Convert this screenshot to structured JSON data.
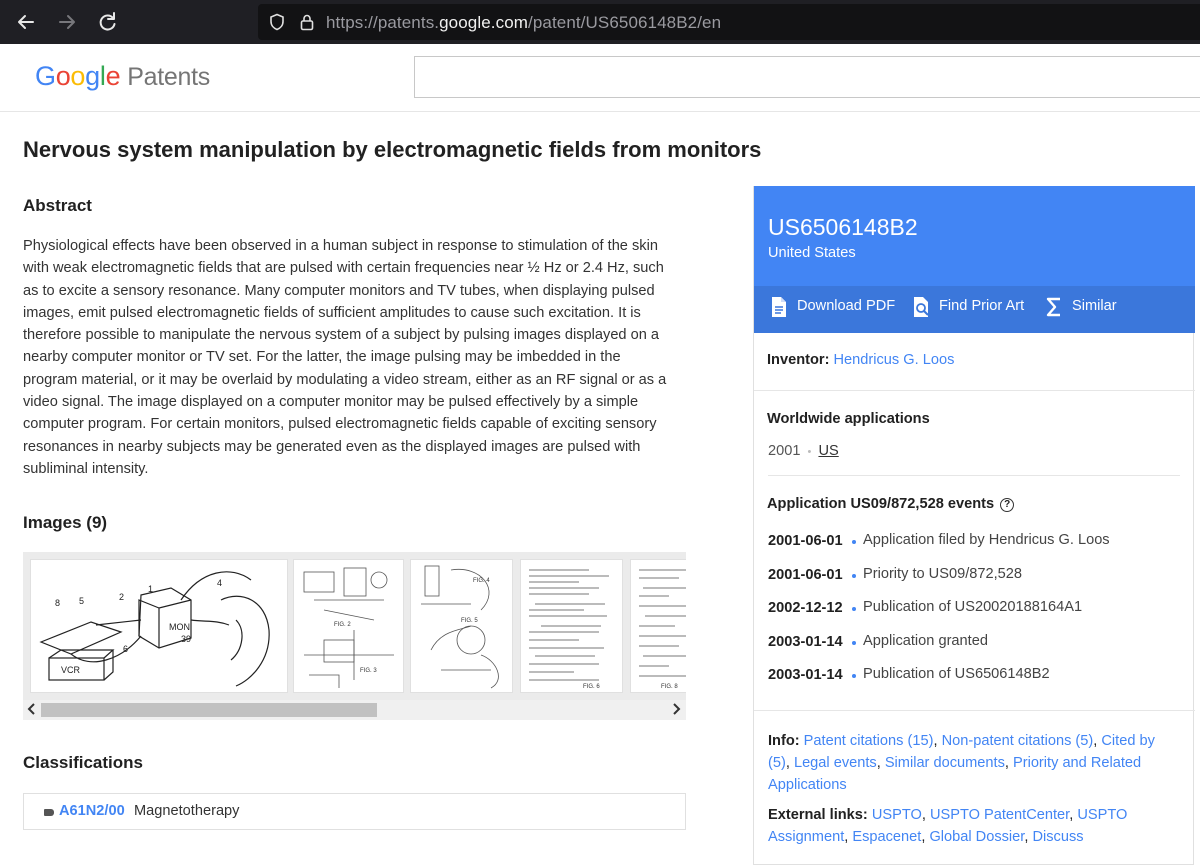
{
  "browser": {
    "url_prefix": "https://patents.",
    "url_host": "google.com",
    "url_path": "/patent/US6506148B2/en"
  },
  "header": {
    "logo_letters": [
      "G",
      "o",
      "o",
      "g",
      "l",
      "e"
    ],
    "logo_product": "Patents"
  },
  "patent": {
    "title": "Nervous system manipulation by electromagnetic fields from monitors",
    "abstract_heading": "Abstract",
    "abstract": "Physiological effects have been observed in a human subject in response to stimulation of the skin with weak electromagnetic fields that are pulsed with certain frequencies near ½ Hz or 2.4 Hz, such as to excite a sensory resonance. Many computer monitors and TV tubes, when displaying pulsed images, emit pulsed electromagnetic fields of sufficient amplitudes to cause such excitation. It is therefore possible to manipulate the nervous system of a subject by pulsing images displayed on a nearby computer monitor or TV set. For the latter, the image pulsing may be imbedded in the program material, or it may be overlaid by modulating a video stream, either as an RF signal or as a video signal. The image displayed on a computer monitor may be pulsed effectively by a simple computer program. For certain monitors, pulsed electromagnetic fields capable of exciting sensory resonances in nearby subjects may be generated even as the displayed images are pulsed with subliminal intensity.",
    "images_heading": "Images (9)",
    "figure_labels": {
      "fig1_labels": [
        "8",
        "5",
        "2",
        "1",
        "4",
        "6",
        "39",
        "VCR",
        "MON"
      ],
      "fig2": "FIG. 2",
      "fig3": "FIG. 3",
      "fig4": "FIG. 4",
      "fig5": "FIG. 5",
      "fig6": "FIG. 6",
      "fig8": "FIG. 8"
    },
    "classifications_heading": "Classifications",
    "classification": {
      "code": "A61N2/00",
      "description": "Magnetotherapy"
    }
  },
  "panel": {
    "publication_number": "US6506148B2",
    "country": "United States",
    "actions": [
      {
        "label": "Download PDF",
        "icon": "document-icon"
      },
      {
        "label": "Find Prior Art",
        "icon": "search-document-icon"
      },
      {
        "label": "Similar",
        "icon": "sigma-icon"
      }
    ],
    "inventor_label": "Inventor:",
    "inventor": "Hendricus G. Loos",
    "worldwide_heading": "Worldwide applications",
    "worldwide_year": "2001",
    "worldwide_country": "US",
    "events_heading": "Application US09/872,528 events",
    "events": [
      {
        "date": "2001-06-01",
        "text": "Application filed by Hendricus G. Loos"
      },
      {
        "date": "2001-06-01",
        "text": "Priority to US09/872,528"
      },
      {
        "date": "2002-12-12",
        "text": "Publication of US20020188164A1"
      },
      {
        "date": "2003-01-14",
        "text": "Application granted"
      },
      {
        "date": "2003-01-14",
        "text": "Publication of US6506148B2"
      }
    ],
    "info_label": "Info:",
    "info_links": [
      "Patent citations (15)",
      "Non-patent citations (5)",
      "Cited by (5)",
      "Legal events",
      "Similar documents",
      "Priority and Related Applications"
    ],
    "external_label": "External links:",
    "external_links": [
      "USPTO",
      "USPTO PatentCenter",
      "USPTO Assignment",
      "Espacenet",
      "Global Dossier",
      "Discuss"
    ]
  },
  "colors": {
    "accent": "#4285f4",
    "accent_dark": "#3b77db"
  }
}
